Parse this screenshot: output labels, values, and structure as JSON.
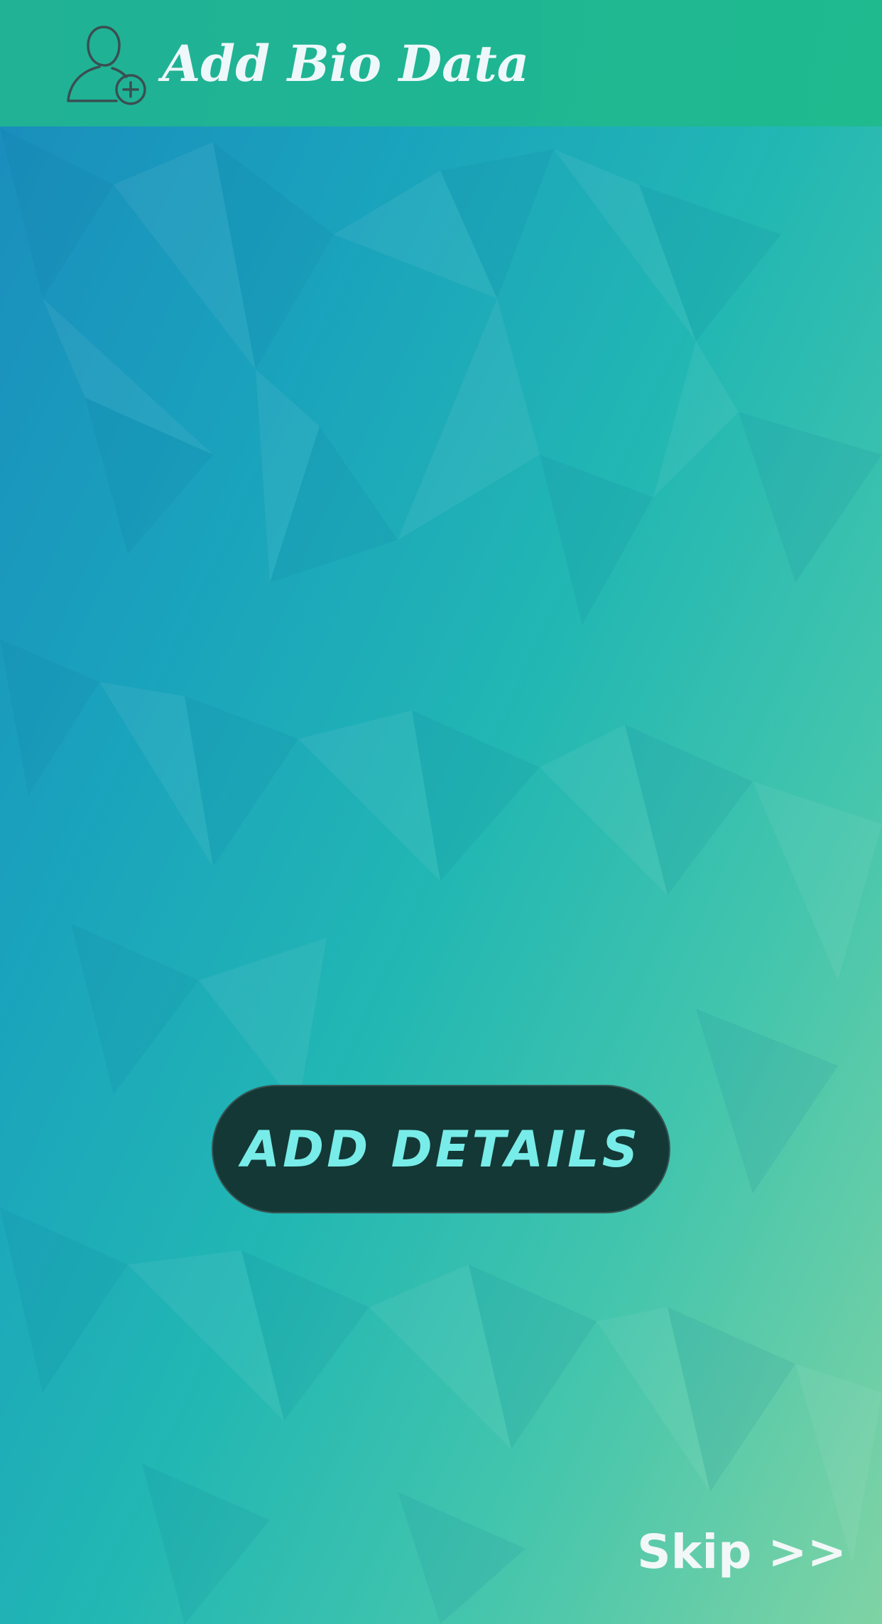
{
  "header": {
    "icon": "add-user-icon",
    "title": "Add Bio Data"
  },
  "main": {
    "add_button_label": "ADD DETAILS"
  },
  "footer": {
    "skip_label": "Skip >>"
  },
  "colors": {
    "header_bg": "#1fb88f",
    "button_bg": "#133836",
    "button_text": "#78ece8",
    "title_text": "#ffffff",
    "skip_text": "#f2f7f7",
    "icon_stroke": "#3d4a4a"
  }
}
